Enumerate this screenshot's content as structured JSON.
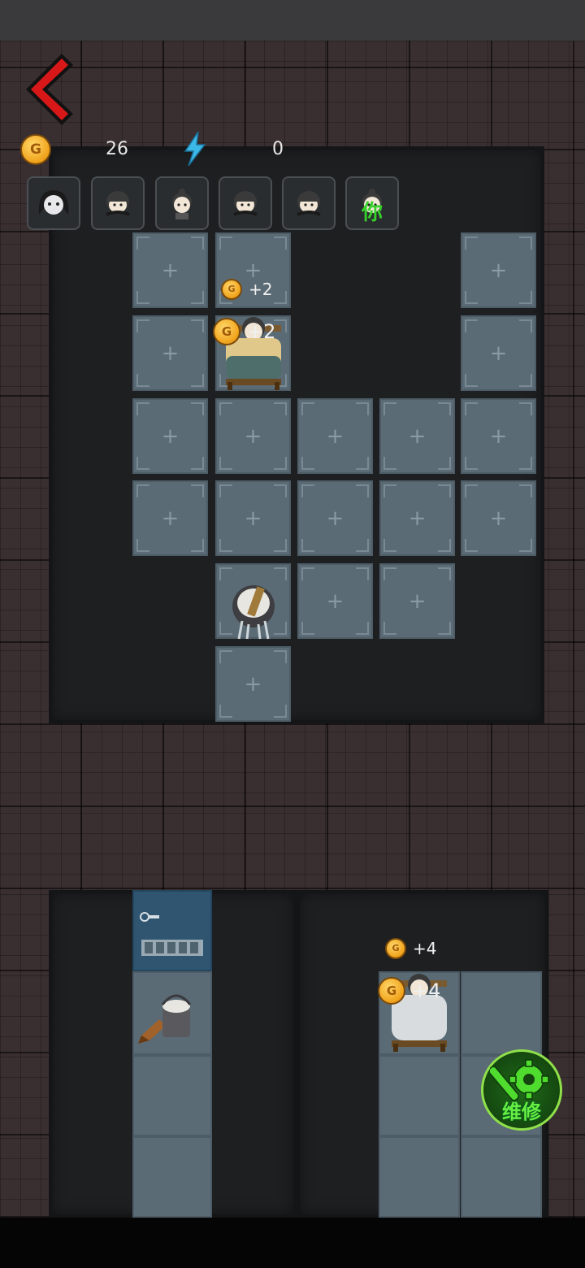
{
  "hud": {
    "gold_value": "26",
    "energy_value": "0",
    "coin_letter": "G"
  },
  "characters": [
    {
      "name": "ghost-girl",
      "label": ""
    },
    {
      "name": "roommate-1",
      "label": ""
    },
    {
      "name": "roommate-2",
      "label": ""
    },
    {
      "name": "roommate-3",
      "label": ""
    },
    {
      "name": "roommate-4",
      "label": ""
    },
    {
      "name": "player",
      "label": "你"
    }
  ],
  "room1": {
    "income_upper": "+2",
    "income_lower": "+2",
    "plus_symbol": "+"
  },
  "room2": {
    "income_upper": "+4",
    "income_lower": "+4"
  },
  "actions": {
    "repair_label": "维修"
  },
  "colors": {
    "repair_green": "#66ee44",
    "back_red": "#d81818",
    "floor": "#5a6b76"
  }
}
